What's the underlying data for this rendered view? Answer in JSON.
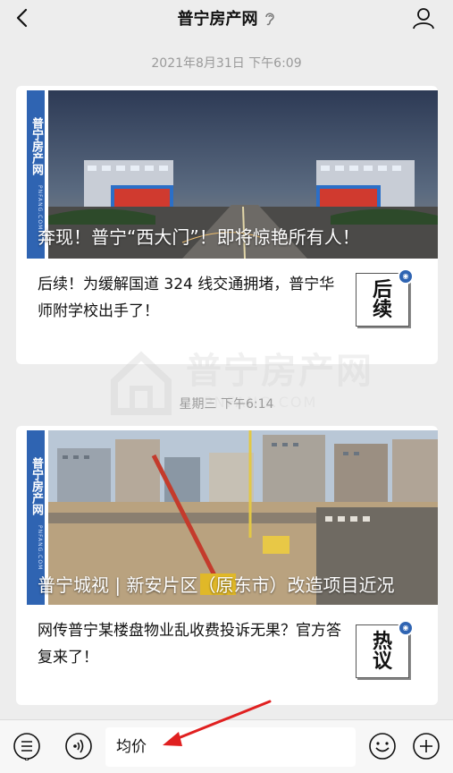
{
  "header": {
    "title": "普宁房产网"
  },
  "messages": [
    {
      "timestamp": "2021年8月31日 下午6:09",
      "hero_title": "奔现！普宁“西大门”！即将惊艳所有人！",
      "sub_title": "后续！为缓解国道 324 线交通拥堵，普宁华师附学校出手了！",
      "thumb_label": "后续"
    },
    {
      "timestamp": "星期三 下午6:14",
      "hero_title": "普宁城视 | 新安片区（原东市）改造项目近况",
      "sub_title": "网传普宁某楼盘物业乱收费投诉无果？官方答复来了！",
      "thumb_label": "热议"
    }
  ],
  "brand": {
    "side_label": "普宁房产网",
    "side_url": "PNFANG.COM"
  },
  "watermark": {
    "text": "普宁房产网",
    "url": "PNFANG.COM"
  },
  "input": {
    "value": "均价"
  },
  "icons": {
    "back": "chevron-left-icon",
    "ear": "ear-icon",
    "profile": "person-icon",
    "menu": "menu-icon",
    "voice": "voice-icon",
    "emoji": "emoji-icon",
    "plus": "plus-icon"
  },
  "colors": {
    "brand_blue": "#2f64b2",
    "arrow_red": "#e02020",
    "background": "#ededed"
  }
}
